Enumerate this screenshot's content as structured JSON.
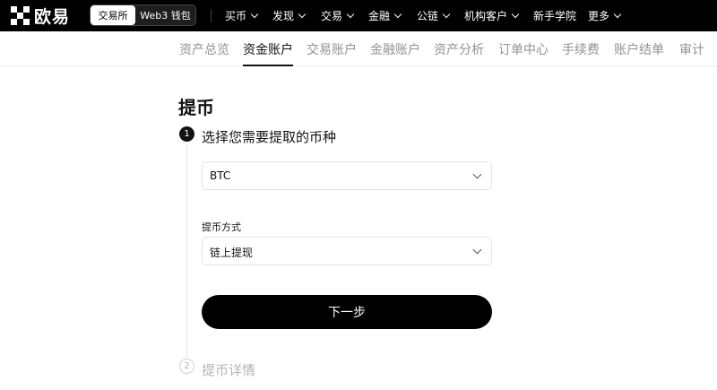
{
  "brand": {
    "logo_text": "欧易"
  },
  "mode_switch": {
    "active": "交易所",
    "inactive": "Web3 钱包"
  },
  "menu": [
    {
      "label": "买币",
      "has_dropdown": true
    },
    {
      "label": "发现",
      "has_dropdown": true
    },
    {
      "label": "交易",
      "has_dropdown": true
    },
    {
      "label": "金融",
      "has_dropdown": true
    },
    {
      "label": "公链",
      "has_dropdown": true
    },
    {
      "label": "机构客户",
      "has_dropdown": true
    },
    {
      "label": "新手学院",
      "has_dropdown": false
    },
    {
      "label": "更多",
      "has_dropdown": true
    }
  ],
  "tabs": [
    {
      "label": "资产总览",
      "active": false
    },
    {
      "label": "资金账户",
      "active": true
    },
    {
      "label": "交易账户",
      "active": false
    },
    {
      "label": "金融账户",
      "active": false
    },
    {
      "label": "资产分析",
      "active": false
    },
    {
      "label": "订单中心",
      "active": false
    },
    {
      "label": "手续费",
      "active": false
    },
    {
      "label": "账户结单",
      "active": false
    },
    {
      "label": "审计",
      "active": false
    }
  ],
  "page": {
    "title": "提币",
    "step1": {
      "number": "1",
      "label": "选择您需要提取的币种"
    },
    "coin_select": {
      "value": "BTC"
    },
    "method": {
      "label": "提币方式",
      "value": "链上提现"
    },
    "next_button": "下一步",
    "step2": {
      "number": "2",
      "label": "提币详情"
    }
  }
}
